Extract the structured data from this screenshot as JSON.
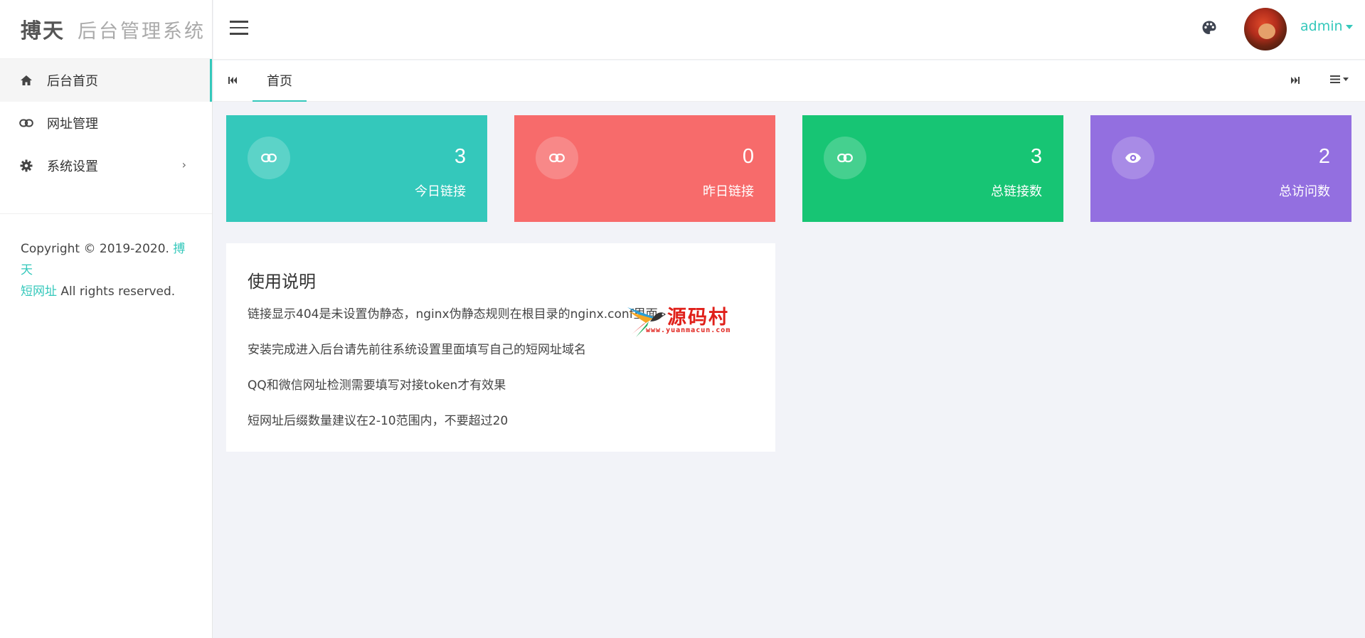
{
  "sidebar": {
    "logo_brand": "搏天",
    "logo_sub": "后台管理系统",
    "items": [
      {
        "label": "后台首页",
        "icon": "home-icon"
      },
      {
        "label": "网址管理",
        "icon": "link-icon"
      },
      {
        "label": "系统设置",
        "icon": "gear-icon"
      }
    ],
    "copyright_prefix": "Copyright © 2019-2020. ",
    "copyright_link_1": "搏天",
    "copyright_link_2": "短网址",
    "copyright_suffix": " All rights reserved."
  },
  "header": {
    "username": "admin"
  },
  "tabs": {
    "items": [
      {
        "label": "首页"
      }
    ]
  },
  "stats": [
    {
      "value": "3",
      "label": "今日链接",
      "icon": "link-icon",
      "color": "#34c8bb"
    },
    {
      "value": "0",
      "label": "昨日链接",
      "icon": "link-icon",
      "color": "#f76b6b"
    },
    {
      "value": "3",
      "label": "总链接数",
      "icon": "link-icon",
      "color": "#17c574"
    },
    {
      "value": "2",
      "label": "总访问数",
      "icon": "eye-icon",
      "color": "#936fe0"
    }
  ],
  "usage": {
    "title": "使用说明",
    "lines": [
      "链接显示404是未设置伪静态，nginx伪静态规则在根目录的nginx.conf里面",
      "安装完成进入后台请先前往系统设置里面填写自己的短网址域名",
      "QQ和微信网址检测需要填写对接token才有效果",
      "短网址后缀数量建议在2-10范围内，不要超过20"
    ]
  },
  "watermark": {
    "text": "源码村",
    "url": "www.yuanmacun.com"
  },
  "colors": {
    "accent": "#34c8bb"
  }
}
